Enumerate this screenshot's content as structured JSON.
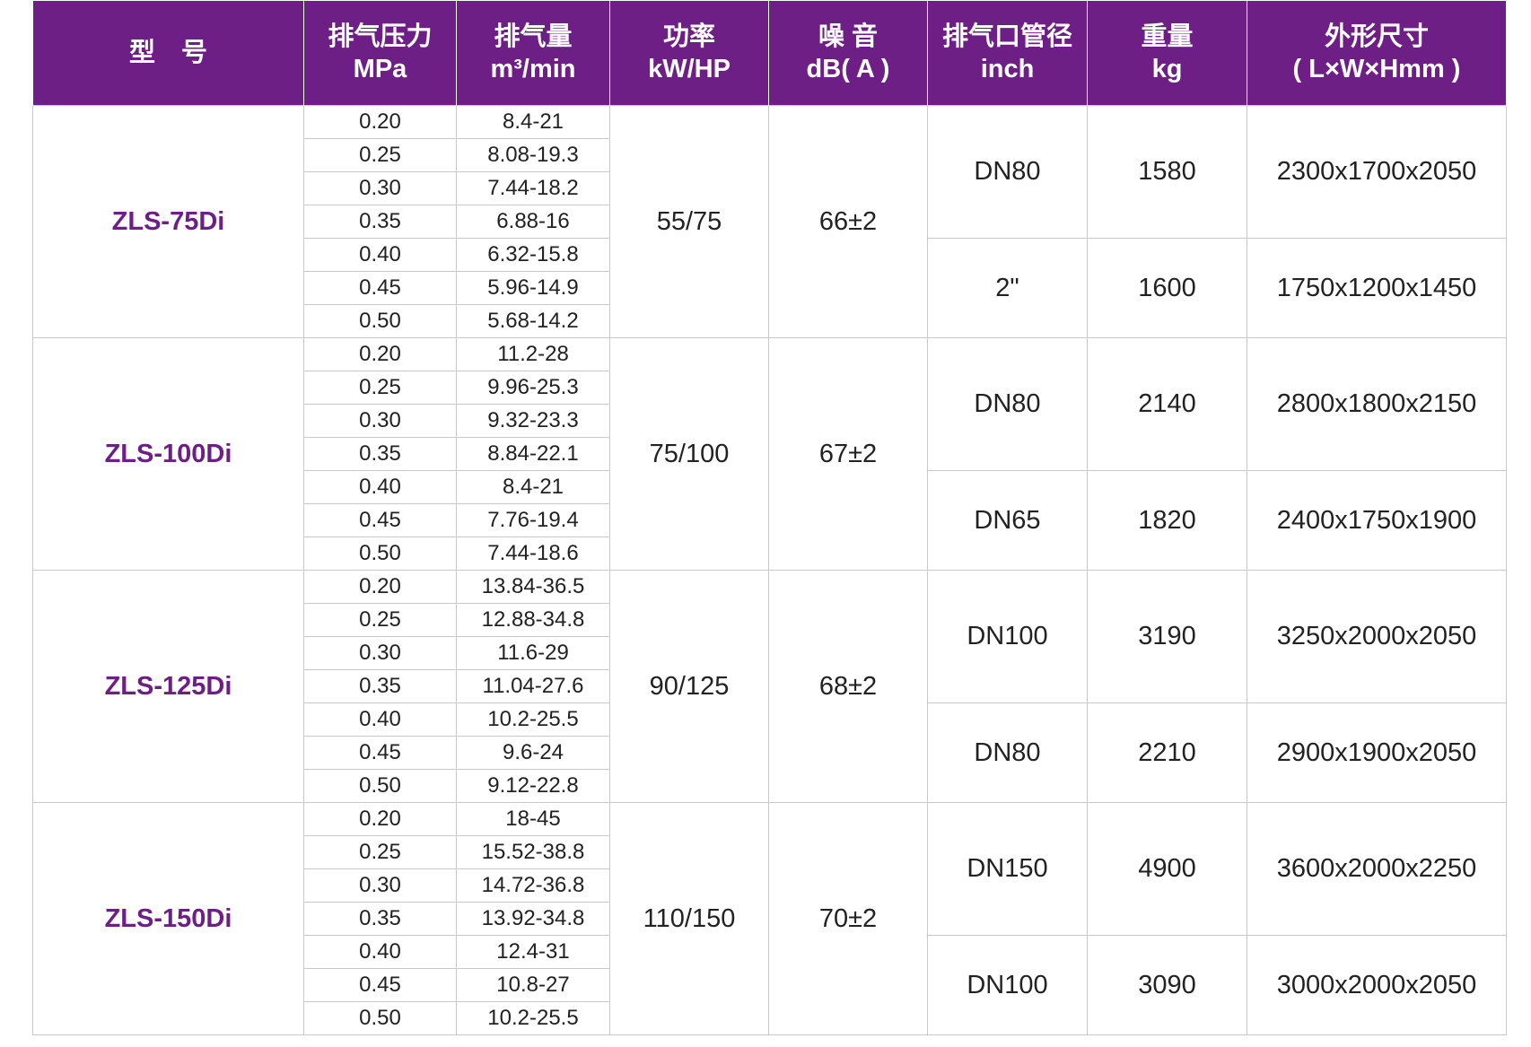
{
  "headers": [
    {
      "line1": "型　号",
      "line2": ""
    },
    {
      "line1": "排气压力",
      "line2": "MPa"
    },
    {
      "line1": "排气量",
      "line2": "m³/min"
    },
    {
      "line1": "功率",
      "line2": "kW/HP"
    },
    {
      "line1": "噪 音",
      "line2": "dB( A )"
    },
    {
      "line1": "排气口管径",
      "line2": "inch"
    },
    {
      "line1": "重量",
      "line2": "kg"
    },
    {
      "line1": "外形尺寸",
      "line2": "( L×W×Hmm )"
    }
  ],
  "models": [
    {
      "name": "ZLS-75Di",
      "power": "55/75",
      "noise": "66±2",
      "rows": [
        {
          "pressure": "0.20",
          "flow": "8.4-21"
        },
        {
          "pressure": "0.25",
          "flow": "8.08-19.3"
        },
        {
          "pressure": "0.30",
          "flow": "7.44-18.2"
        },
        {
          "pressure": "0.35",
          "flow": "6.88-16"
        },
        {
          "pressure": "0.40",
          "flow": "6.32-15.8"
        },
        {
          "pressure": "0.45",
          "flow": "5.96-14.9"
        },
        {
          "pressure": "0.50",
          "flow": "5.68-14.2"
        }
      ],
      "variants": [
        {
          "outlet": "DN80",
          "weight": "1580",
          "dims": "2300x1700x2050"
        },
        {
          "outlet": "2\"",
          "weight": "1600",
          "dims": "1750x1200x1450"
        }
      ]
    },
    {
      "name": "ZLS-100Di",
      "power": "75/100",
      "noise": "67±2",
      "rows": [
        {
          "pressure": "0.20",
          "flow": "11.2-28"
        },
        {
          "pressure": "0.25",
          "flow": "9.96-25.3"
        },
        {
          "pressure": "0.30",
          "flow": "9.32-23.3"
        },
        {
          "pressure": "0.35",
          "flow": "8.84-22.1"
        },
        {
          "pressure": "0.40",
          "flow": "8.4-21"
        },
        {
          "pressure": "0.45",
          "flow": "7.76-19.4"
        },
        {
          "pressure": "0.50",
          "flow": "7.44-18.6"
        }
      ],
      "variants": [
        {
          "outlet": "DN80",
          "weight": "2140",
          "dims": "2800x1800x2150"
        },
        {
          "outlet": "DN65",
          "weight": "1820",
          "dims": "2400x1750x1900"
        }
      ]
    },
    {
      "name": "ZLS-125Di",
      "power": "90/125",
      "noise": "68±2",
      "rows": [
        {
          "pressure": "0.20",
          "flow": "13.84-36.5"
        },
        {
          "pressure": "0.25",
          "flow": "12.88-34.8"
        },
        {
          "pressure": "0.30",
          "flow": "11.6-29"
        },
        {
          "pressure": "0.35",
          "flow": "11.04-27.6"
        },
        {
          "pressure": "0.40",
          "flow": "10.2-25.5"
        },
        {
          "pressure": "0.45",
          "flow": "9.6-24"
        },
        {
          "pressure": "0.50",
          "flow": "9.12-22.8"
        }
      ],
      "variants": [
        {
          "outlet": "DN100",
          "weight": "3190",
          "dims": "3250x2000x2050"
        },
        {
          "outlet": "DN80",
          "weight": "2210",
          "dims": "2900x1900x2050"
        }
      ]
    },
    {
      "name": "ZLS-150Di",
      "power": "110/150",
      "noise": "70±2",
      "rows": [
        {
          "pressure": "0.20",
          "flow": "18-45"
        },
        {
          "pressure": "0.25",
          "flow": "15.52-38.8"
        },
        {
          "pressure": "0.30",
          "flow": "14.72-36.8"
        },
        {
          "pressure": "0.35",
          "flow": "13.92-34.8"
        },
        {
          "pressure": "0.40",
          "flow": "12.4-31"
        },
        {
          "pressure": "0.45",
          "flow": "10.8-27"
        },
        {
          "pressure": "0.50",
          "flow": "10.2-25.5"
        }
      ],
      "variants": [
        {
          "outlet": "DN150",
          "weight": "4900",
          "dims": "3600x2000x2250"
        },
        {
          "outlet": "DN100",
          "weight": "3090",
          "dims": "3000x2000x2050"
        }
      ]
    }
  ],
  "colors": {
    "header_bg": "#6e1f86",
    "model_text": "#6e1f86",
    "border": "#c9c9c9"
  }
}
